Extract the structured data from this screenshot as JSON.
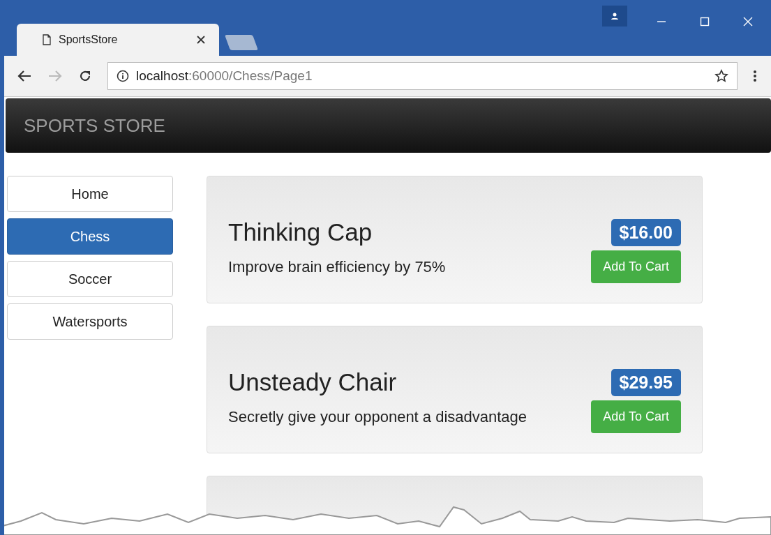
{
  "browser": {
    "tab_title": "SportsStore",
    "address": {
      "host": "localhost",
      "rest": ":60000/Chess/Page1"
    }
  },
  "navbar": {
    "brand": "SPORTS STORE"
  },
  "categories": [
    {
      "label": "Home",
      "selected": false
    },
    {
      "label": "Chess",
      "selected": true
    },
    {
      "label": "Soccer",
      "selected": false
    },
    {
      "label": "Watersports",
      "selected": false
    }
  ],
  "products": [
    {
      "name": "Thinking Cap",
      "description": "Improve brain efficiency by 75%",
      "price": "$16.00",
      "button": "Add To Cart"
    },
    {
      "name": "Unsteady Chair",
      "description": "Secretly give your opponent a disadvantage",
      "price": "$29.95",
      "button": "Add To Cart"
    }
  ]
}
